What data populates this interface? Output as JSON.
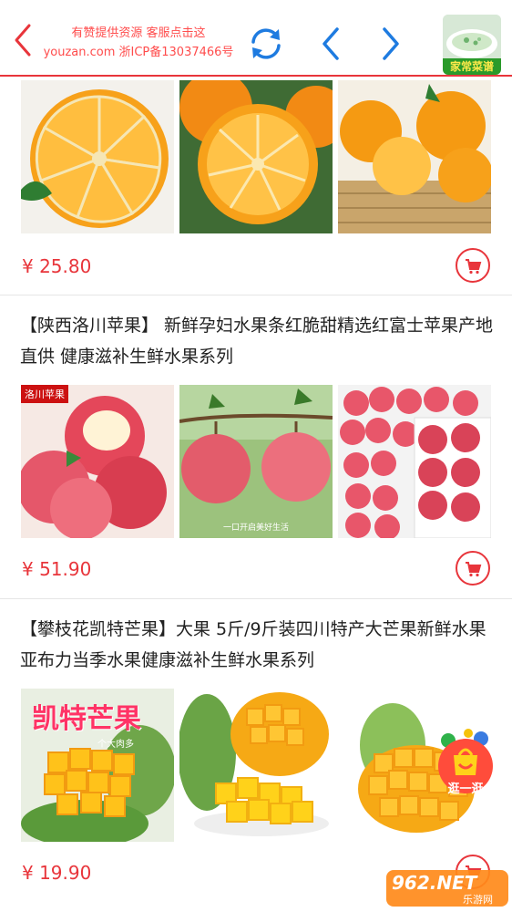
{
  "header": {
    "line1": "有赞提供资源 客服点击这",
    "line2": "youzan.com 浙ICP备13037466号",
    "thumb_label": "家常菜谱"
  },
  "products": [
    {
      "title": "",
      "price": "¥ 25.80"
    },
    {
      "title": "【陕西洛川苹果】 新鲜孕妇水果条红脆甜精选红富士苹果产地直供 健康滋补生鲜水果系列",
      "price": "¥ 51.90",
      "image_badge": "洛川苹果",
      "image_caption": "一口开启美好生活"
    },
    {
      "title": "【攀枝花凯特芒果】大果 5斤/9斤装四川特产大芒果新鲜水果 亚布力当季水果健康滋补生鲜水果系列",
      "price": "¥ 19.90",
      "image_title": "凯特芒果",
      "image_sub": "个大肉多"
    }
  ],
  "floating": {
    "shop_label": "逛一逛"
  },
  "watermark": {
    "text": "962.NET",
    "sub": "乐游网"
  },
  "colors": {
    "accent": "#e8353b",
    "header_text": "#ff4c4c",
    "icon_blue": "#1e7be0"
  }
}
